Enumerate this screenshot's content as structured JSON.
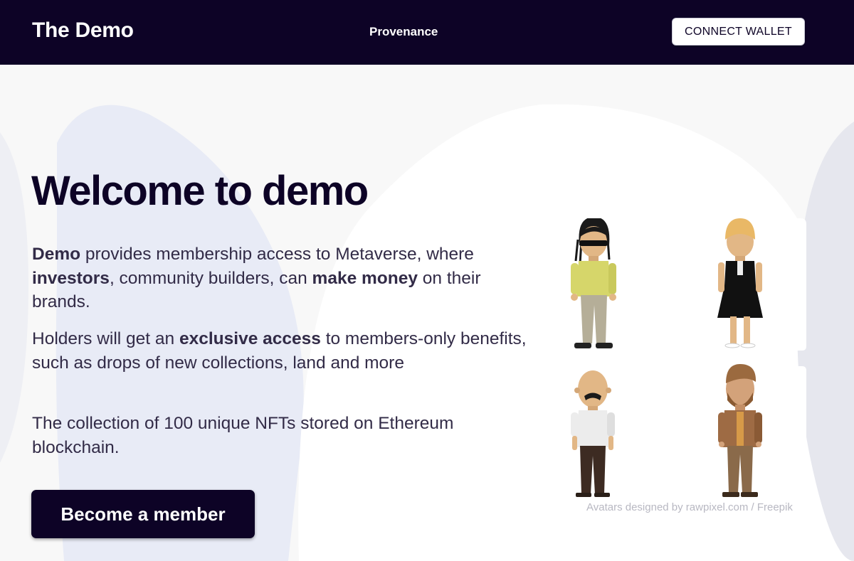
{
  "nav": {
    "brand": "The Demo",
    "link": "Provenance",
    "connect_label": "CONNECT WALLET"
  },
  "hero": {
    "title": "Welcome to demo",
    "para1": {
      "brand": "Demo",
      "t1": " provides membership access to Metaverse, where ",
      "b1": "investors",
      "t2": ", community builders, can ",
      "b2": "make money",
      "t3": " on their brands."
    },
    "para2": {
      "t1": "Holders will get an ",
      "b1": "exclusive access",
      "t2": " to members-only benefits, such as drops of new collections, land and more"
    },
    "para3": "The collection of 100 unique NFTs stored on Ethereum blockchain.",
    "cta_label": "Become a member",
    "credit": "Avatars designed by rawpixel.com / Freepik"
  },
  "avatars": [
    {
      "name": "man-dreadlocks-sunglasses-icon",
      "shirt": "#d6d66a",
      "pants": "#b5ae98",
      "skin": "#e2b786"
    },
    {
      "name": "woman-blonde-black-dress-icon",
      "dress": "#111111",
      "hair": "#e9b866",
      "skin": "#e2b786"
    },
    {
      "name": "bald-man-mustache-icon",
      "shirt": "#ececec",
      "pants": "#3d2b22",
      "skin": "#e2b786"
    },
    {
      "name": "bearded-man-brown-jacket-icon",
      "jacket": "#9e6b44",
      "pants": "#8a6a4a",
      "skin": "#d3a27a"
    }
  ],
  "colors": {
    "navy": "#0d0326",
    "text": "#322b47",
    "shape_blue": "#e8ebf6",
    "shape_white": "#ffffff",
    "shape_gray": "#e6e7ee"
  }
}
